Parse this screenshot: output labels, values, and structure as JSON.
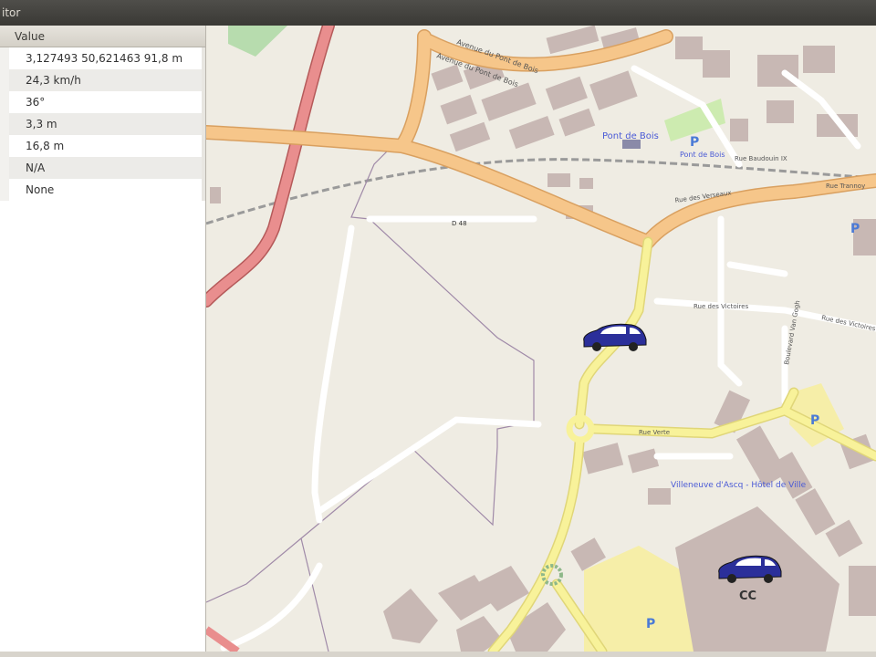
{
  "window": {
    "title": "itor"
  },
  "panel": {
    "column_header": "Value",
    "rows": [
      "3,127493 50,621463 91,8 m",
      "24,3 km/h",
      "36°",
      "3,3 m",
      "16,8 m",
      "N/A",
      "None"
    ]
  },
  "map": {
    "labels": {
      "avenue_pont_de_bois_1": "Avenue du Pont de Bois",
      "avenue_pont_de_bois_2": "Avenue du Pont de Bois",
      "pont_de_bois": "Pont de Bois",
      "pont_de_bois_station": "Pont de Bois",
      "rue_baudouin": "Rue Baudouin IX",
      "rue_des_verseaux": "Rue des Verseaux",
      "rue_trannoy": "Rue Trannoy",
      "d48": "D 48",
      "rue_des_victoires_1": "Rue des Victoires",
      "rue_des_victoires_2": "Rue des Victoires",
      "rue_verte": "Rue Verte",
      "boulevard_van_gogh": "Boulevard Van Gogh",
      "hotel_de_ville": "Villeneuve d'Ascq - Hôtel de Ville",
      "cc_label": "CC"
    },
    "parking_symbol": "P",
    "colors": {
      "background": "#efece3",
      "primary_road": "#f6c68a",
      "trunk_road": "#e98e8e",
      "secondary_road": "#f8f29a",
      "building": "#c8b8b4",
      "car": "#2b2f9a"
    }
  }
}
